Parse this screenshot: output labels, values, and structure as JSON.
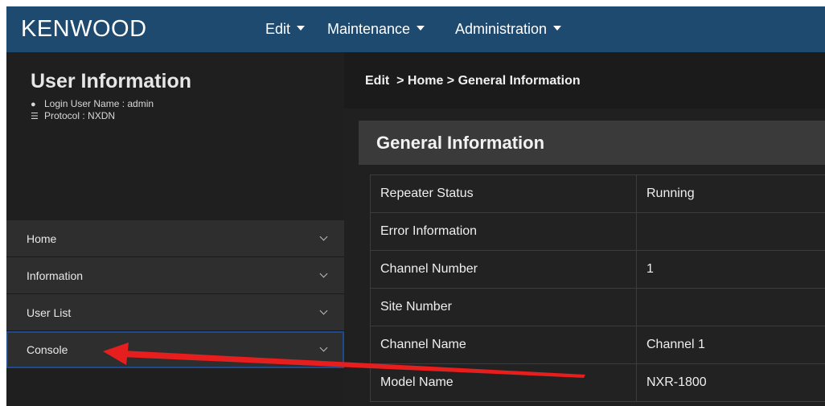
{
  "header": {
    "logo": "KENWOOD",
    "nav": [
      "Edit",
      "Maintenance",
      "Administration"
    ]
  },
  "sidebar": {
    "title": "User Information",
    "login_line": "Login User Name : admin",
    "protocol_line": "Protocol : NXDN",
    "menu": [
      "Home",
      "Information",
      "User List",
      "Console"
    ]
  },
  "main": {
    "breadcrumb": "Edit  > Home > General Information",
    "panel_title": "General Information",
    "rows": [
      {
        "label": "Repeater Status",
        "value": "Running"
      },
      {
        "label": "Error Information",
        "value": ""
      },
      {
        "label": "Channel Number",
        "value": "1"
      },
      {
        "label": "Site Number",
        "value": ""
      },
      {
        "label": "Channel Name",
        "value": "Channel 1"
      },
      {
        "label": "Model Name",
        "value": "NXR-1800"
      }
    ]
  },
  "colors": {
    "header_bg": "#1d4a6e",
    "sidebar_bg": "#1f1f1f",
    "annotation_arrow": "#e61e1e"
  }
}
